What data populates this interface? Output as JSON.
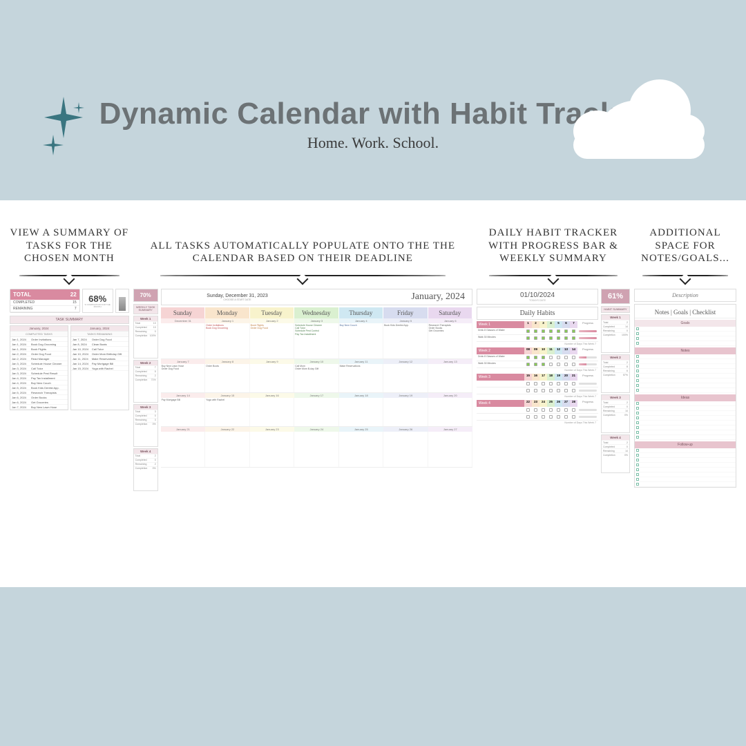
{
  "header": {
    "title": "Dynamic Calendar with Habit Tracker",
    "subtitle": "Home. Work. School."
  },
  "captions": {
    "summary": "VIEW A SUMMARY OF TASKS FOR THE CHOSEN MONTH",
    "calendar": "ALL TASKS AUTOMATICALLY POPULATE ONTO THE THE CALENDAR BASED ON THEIR DEADLINE",
    "habits": "DAILY HABIT TRACKER WITH PROGRESS BAR & WEEKLY SUMMARY",
    "notes": "ADDITIONAL SPACE FOR NOTES/GOALS..."
  },
  "taskSummary": {
    "totalLabel": "TOTAL",
    "totalValue": "22",
    "completedLabel": "COMPLETED",
    "completedValue": "15",
    "remainingLabel": "REMAINING",
    "remainingValue": "7",
    "pct": "68%",
    "pctSub": "% COMPLETION FOR THE MONTH",
    "sumHdr": "TASK SUMMARY",
    "left": {
      "month": "January, 2024",
      "sub": "COMPLETED TASKS",
      "rows": [
        [
          "Jan 1, 2024",
          "Order Invitations"
        ],
        [
          "Jan 1, 2024",
          "Book Dog Grooming"
        ],
        [
          "Jan 1, 2024",
          "Book Flights"
        ],
        [
          "Jan 2, 2024",
          "Order Dog Food"
        ],
        [
          "Jan 2, 2024",
          "Read Manager"
        ],
        [
          "Jan 3, 2024",
          "Schedule House Cleaner"
        ],
        [
          "Jan 3, 2024",
          "Call Tutor"
        ],
        [
          "Jan 3, 2024",
          "Schedule Pest Result"
        ],
        [
          "Jan 4, 2024",
          "Pay Tax Installment"
        ],
        [
          "Jan 4, 2024",
          "Buy New Couch"
        ],
        [
          "Jan 5, 2024",
          "Book Kids Dentist App."
        ],
        [
          "Jan 5, 2024",
          "Research Therapists"
        ],
        [
          "Jan 6, 2024",
          "Order Books"
        ],
        [
          "Jan 6, 2024",
          "Get Groceries"
        ],
        [
          "Jan 7, 2024",
          "Buy New Lawn Hose"
        ]
      ]
    },
    "right": {
      "month": "January, 2024",
      "sub": "TASKS REMAINING",
      "rows": [
        [
          "Jan 7, 2024",
          "Order Dog Food"
        ],
        [
          "Jan 8, 2024",
          "Clean Boats"
        ],
        [
          "Jan 10, 2024",
          "Call Tutor"
        ],
        [
          "Jan 10, 2024",
          "Order Mom Birthday Gift"
        ],
        [
          "Jan 11, 2024",
          "Make Reservations"
        ],
        [
          "Jan 14, 2024",
          "Pay Mortgage Bill"
        ],
        [
          "Jan 15, 2024",
          "Yoga with Rachel"
        ]
      ]
    }
  },
  "calendar": {
    "weeklyPct": "70%",
    "weeklySummaryHdr": "WEEKLY TASK SUMMARY",
    "weeks": [
      {
        "name": "Week 1",
        "total": "10",
        "comp": "10",
        "rem": "0",
        "pct": "100%"
      },
      {
        "name": "Week 2",
        "total": "7",
        "comp": "5",
        "rem": "2",
        "pct": "71%"
      },
      {
        "name": "Week 3",
        "total": "3",
        "comp": "0",
        "rem": "3",
        "pct": "0%"
      },
      {
        "name": "Week 4",
        "total": "2",
        "comp": "0",
        "rem": "2",
        "pct": "0%"
      }
    ],
    "startDate": "Sunday, December 31, 2023",
    "startDateSub": "CHOOSE A START DATE",
    "monthLabel": "January, 2024",
    "dayNames": [
      "Sunday",
      "Monday",
      "Tuesday",
      "Wednesday",
      "Thursday",
      "Friday",
      "Saturday"
    ],
    "weekRows": [
      {
        "dates": [
          "December 31",
          "January 1",
          "January 2",
          "January 3",
          "January 4",
          "January 5",
          "January 6"
        ],
        "events": [
          [
            ""
          ],
          [
            "Order Invitations",
            "Book Dog Grooming"
          ],
          [
            "Book Flights",
            "Order Dog Food"
          ],
          [
            "Schedule House Cleaner",
            "Call Tutor",
            "Schedule Pest Control",
            "Pay Tax Installment"
          ],
          [
            "Buy New Couch"
          ],
          [
            "Book Kids Dentist App."
          ],
          [
            "Research Therapists",
            "Order Books",
            "Get Groceries"
          ]
        ]
      },
      {
        "dates": [
          "January 7",
          "January 8",
          "January 9",
          "January 10",
          "January 11",
          "January 12",
          "January 13"
        ],
        "events": [
          [
            "Buy New Lawn Hose",
            "Order Dog Food"
          ],
          [
            "Order Boots"
          ],
          [
            ""
          ],
          [
            "Call Mom",
            "Order Mom B-day Gift"
          ],
          [
            "Make Reservations"
          ],
          [
            ""
          ],
          [
            ""
          ]
        ]
      },
      {
        "dates": [
          "January 14",
          "January 15",
          "January 16",
          "January 17",
          "January 18",
          "January 19",
          "January 20"
        ],
        "events": [
          [
            "Pay Mortgage Bill"
          ],
          [
            "Yoga with Rachel"
          ],
          [
            ""
          ],
          [
            ""
          ],
          [
            ""
          ],
          [
            ""
          ],
          [
            ""
          ]
        ]
      },
      {
        "dates": [
          "January 21",
          "January 22",
          "January 23",
          "January 24",
          "January 25",
          "January 26",
          "January 27"
        ],
        "events": [
          [
            ""
          ],
          [
            ""
          ],
          [
            ""
          ],
          [
            ""
          ],
          [
            ""
          ],
          [
            ""
          ],
          [
            ""
          ]
        ]
      }
    ],
    "labels": {
      "total": "Total",
      "completed": "Completed",
      "remaining": "Remaining",
      "completion": "Completion"
    }
  },
  "habits": {
    "date": "01/10/2024",
    "dateSub": "TODAYS DATE",
    "pct": "61%",
    "summaryLabel": "HABIT SUMMARY",
    "title": "Daily Habits",
    "dayNums": [
      "1",
      "2",
      "3",
      "4",
      "5",
      "6",
      "7"
    ],
    "progressLabel": "Progress",
    "footerLabel": "Number of Days This Week",
    "weeks": [
      {
        "name": "Week 1",
        "rows": [
          "Drink 8 Glasses of Water",
          "Walk 30 Minutes"
        ],
        "summary": {
          "total": "2",
          "comp": "14",
          "rem": "0",
          "pct": "100%"
        }
      },
      {
        "name": "Week 2",
        "rows": [
          "Drink 8 Glasses of Water",
          "Walk 30 Minutes"
        ],
        "dayNums": [
          "08",
          "09",
          "10",
          "11",
          "12",
          "13",
          "14"
        ],
        "summary": {
          "total": "2",
          "comp": "8",
          "rem": "6",
          "pct": "57%"
        }
      },
      {
        "name": "Week 3",
        "rows": [
          "",
          ""
        ],
        "dayNums": [
          "15",
          "16",
          "17",
          "18",
          "19",
          "20",
          "21"
        ],
        "summary": {
          "total": "2",
          "comp": "0",
          "rem": "14",
          "pct": "0%"
        }
      },
      {
        "name": "Week 4",
        "rows": [
          "",
          ""
        ],
        "dayNums": [
          "22",
          "23",
          "24",
          "25",
          "26",
          "27",
          "28"
        ],
        "summary": {
          "total": "2",
          "comp": "0",
          "rem": "14",
          "pct": "0%"
        }
      }
    ],
    "labels": {
      "total": "Total",
      "completed": "Completed",
      "remaining": "Remaining",
      "completion": "Completion"
    }
  },
  "notes": {
    "descLabel": "Description",
    "mainHdr": "Notes | Goals | Checklist",
    "sections": [
      "Goals",
      "Notes",
      "Ideas",
      "Follow-up"
    ]
  }
}
